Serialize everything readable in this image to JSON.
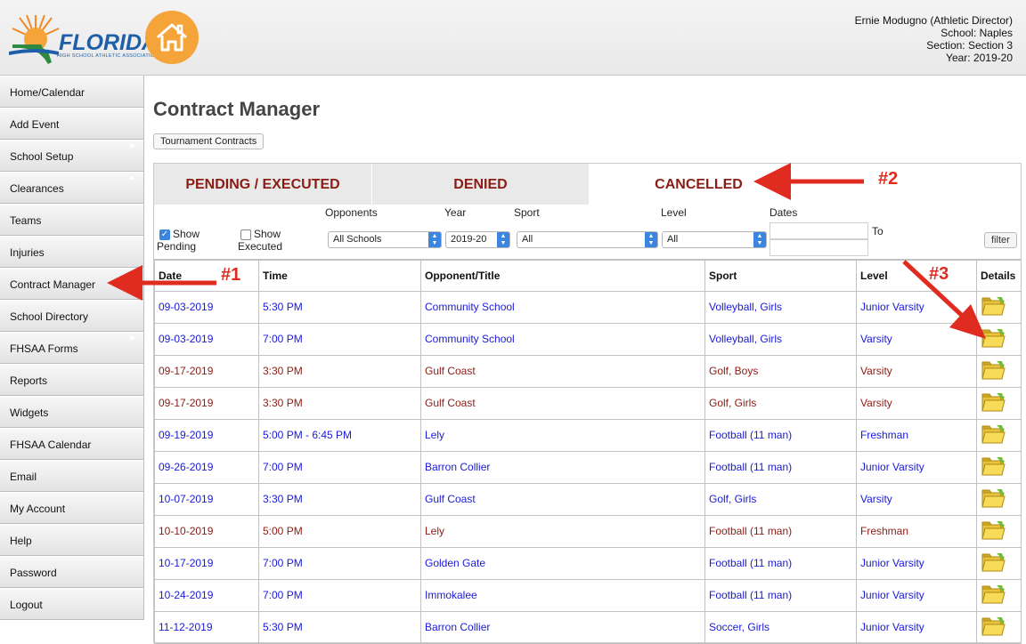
{
  "header": {
    "logo_text": "FLORIDA",
    "logo_subtext": "HIGH SCHOOL ATHLETIC ASSOCIATION",
    "user_lines": [
      "Ernie Modugno (Athletic Director)",
      "School: Naples",
      "Section: Section 3",
      "Year: 2019-20"
    ]
  },
  "sidebar": {
    "items": [
      {
        "label": "Home/Calendar",
        "submenu": false
      },
      {
        "label": "Add Event",
        "submenu": false
      },
      {
        "label": "School Setup",
        "submenu": true
      },
      {
        "label": "Clearances",
        "submenu": true
      },
      {
        "label": "Teams",
        "submenu": false
      },
      {
        "label": "Injuries",
        "submenu": false
      },
      {
        "label": "Contract Manager",
        "submenu": false
      },
      {
        "label": "School Directory",
        "submenu": false
      },
      {
        "label": "FHSAA Forms",
        "submenu": true
      },
      {
        "label": "Reports",
        "submenu": false
      },
      {
        "label": "Widgets",
        "submenu": false
      },
      {
        "label": "FHSAA Calendar",
        "submenu": false
      },
      {
        "label": "Email",
        "submenu": false
      },
      {
        "label": "My Account",
        "submenu": false
      },
      {
        "label": "Help",
        "submenu": false
      },
      {
        "label": "Password",
        "submenu": false
      },
      {
        "label": "Logout",
        "submenu": false
      }
    ]
  },
  "main": {
    "title": "Contract Manager",
    "tournament_button": "Tournament Contracts",
    "tabs": [
      {
        "label": "PENDING / EXECUTED",
        "active": false
      },
      {
        "label": "DENIED",
        "active": false
      },
      {
        "label": "CANCELLED",
        "active": true
      }
    ],
    "filters": {
      "show_pending_label_1": "Show",
      "show_pending_label_2": "Pending",
      "show_pending_checked": true,
      "show_executed_label_1": "Show",
      "show_executed_label_2": "Executed",
      "show_executed_checked": false,
      "opponents_label": "Opponents",
      "opponents_value": "All Schools",
      "year_label": "Year",
      "year_value": "2019-20",
      "sport_label": "Sport",
      "sport_value": "All",
      "level_label": "Level",
      "level_value": "All",
      "dates_label": "Dates",
      "to_label": "To",
      "filter_button": "filter"
    },
    "table": {
      "columns": [
        "Date",
        "Time",
        "Opponent/Title",
        "Sport",
        "Level",
        "Details"
      ],
      "rows": [
        {
          "date": "09-03-2019",
          "time": "5:30 PM",
          "opponent": "Community School",
          "sport": "Volleyball, Girls",
          "level": "Junior Varsity",
          "status": "pending"
        },
        {
          "date": "09-03-2019",
          "time": "7:00 PM",
          "opponent": "Community School",
          "sport": "Volleyball, Girls",
          "level": "Varsity",
          "status": "pending"
        },
        {
          "date": "09-17-2019",
          "time": "3:30 PM",
          "opponent": "Gulf Coast",
          "sport": "Golf, Boys",
          "level": "Varsity",
          "status": "executed"
        },
        {
          "date": "09-17-2019",
          "time": "3:30 PM",
          "opponent": "Gulf Coast",
          "sport": "Golf, Girls",
          "level": "Varsity",
          "status": "executed"
        },
        {
          "date": "09-19-2019",
          "time": "5:00 PM - 6:45 PM",
          "opponent": "Lely",
          "sport": "Football (11 man)",
          "level": "Freshman",
          "status": "pending"
        },
        {
          "date": "09-26-2019",
          "time": "7:00 PM",
          "opponent": "Barron Collier",
          "sport": "Football (11 man)",
          "level": "Junior Varsity",
          "status": "pending"
        },
        {
          "date": "10-07-2019",
          "time": "3:30 PM",
          "opponent": "Gulf Coast",
          "sport": "Golf, Girls",
          "level": "Varsity",
          "status": "pending"
        },
        {
          "date": "10-10-2019",
          "time": "5:00 PM",
          "opponent": "Lely",
          "sport": "Football (11 man)",
          "level": "Freshman",
          "status": "executed"
        },
        {
          "date": "10-17-2019",
          "time": "7:00 PM",
          "opponent": "Golden Gate",
          "sport": "Football (11 man)",
          "level": "Junior Varsity",
          "status": "pending"
        },
        {
          "date": "10-24-2019",
          "time": "7:00 PM",
          "opponent": "Immokalee",
          "sport": "Football (11 man)",
          "level": "Junior Varsity",
          "status": "pending"
        },
        {
          "date": "11-12-2019",
          "time": "5:30 PM",
          "opponent": "Barron Collier",
          "sport": "Soccer, Girls",
          "level": "Junior Varsity",
          "status": "pending"
        }
      ],
      "details_icon": "folder-icon"
    }
  },
  "annotations": {
    "label_1": "#1",
    "label_2": "#2",
    "label_3": "#3",
    "color": "#e02b20"
  }
}
